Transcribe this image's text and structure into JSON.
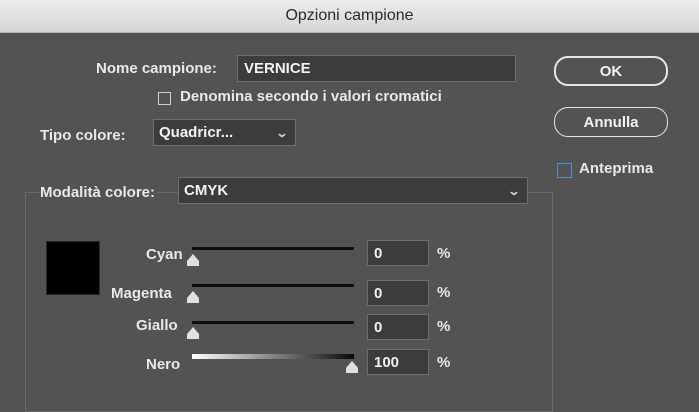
{
  "window": {
    "title": "Opzioni campione"
  },
  "swatch_name": {
    "label": "Nome campione:",
    "value": "VERNICE"
  },
  "name_by_value": {
    "label": "Denomina secondo i valori cromatici",
    "checked": false
  },
  "color_type": {
    "label": "Tipo colore:",
    "value": "Quadricr..."
  },
  "color_mode": {
    "label": "Modalità colore:",
    "value": "CMYK"
  },
  "buttons": {
    "ok": "OK",
    "cancel": "Annulla"
  },
  "preview": {
    "label": "Anteprima",
    "checked": false
  },
  "swatch_color": "#000000",
  "channels": [
    {
      "name": "Cyan",
      "value": "0",
      "unit": "%"
    },
    {
      "name": "Magenta",
      "value": "0",
      "unit": "%"
    },
    {
      "name": "Giallo",
      "value": "0",
      "unit": "%"
    },
    {
      "name": "Nero",
      "value": "100",
      "unit": "%"
    }
  ],
  "colors": {
    "background": "#535353",
    "field": "#3c3c3c",
    "accent": "#4a90e2"
  }
}
